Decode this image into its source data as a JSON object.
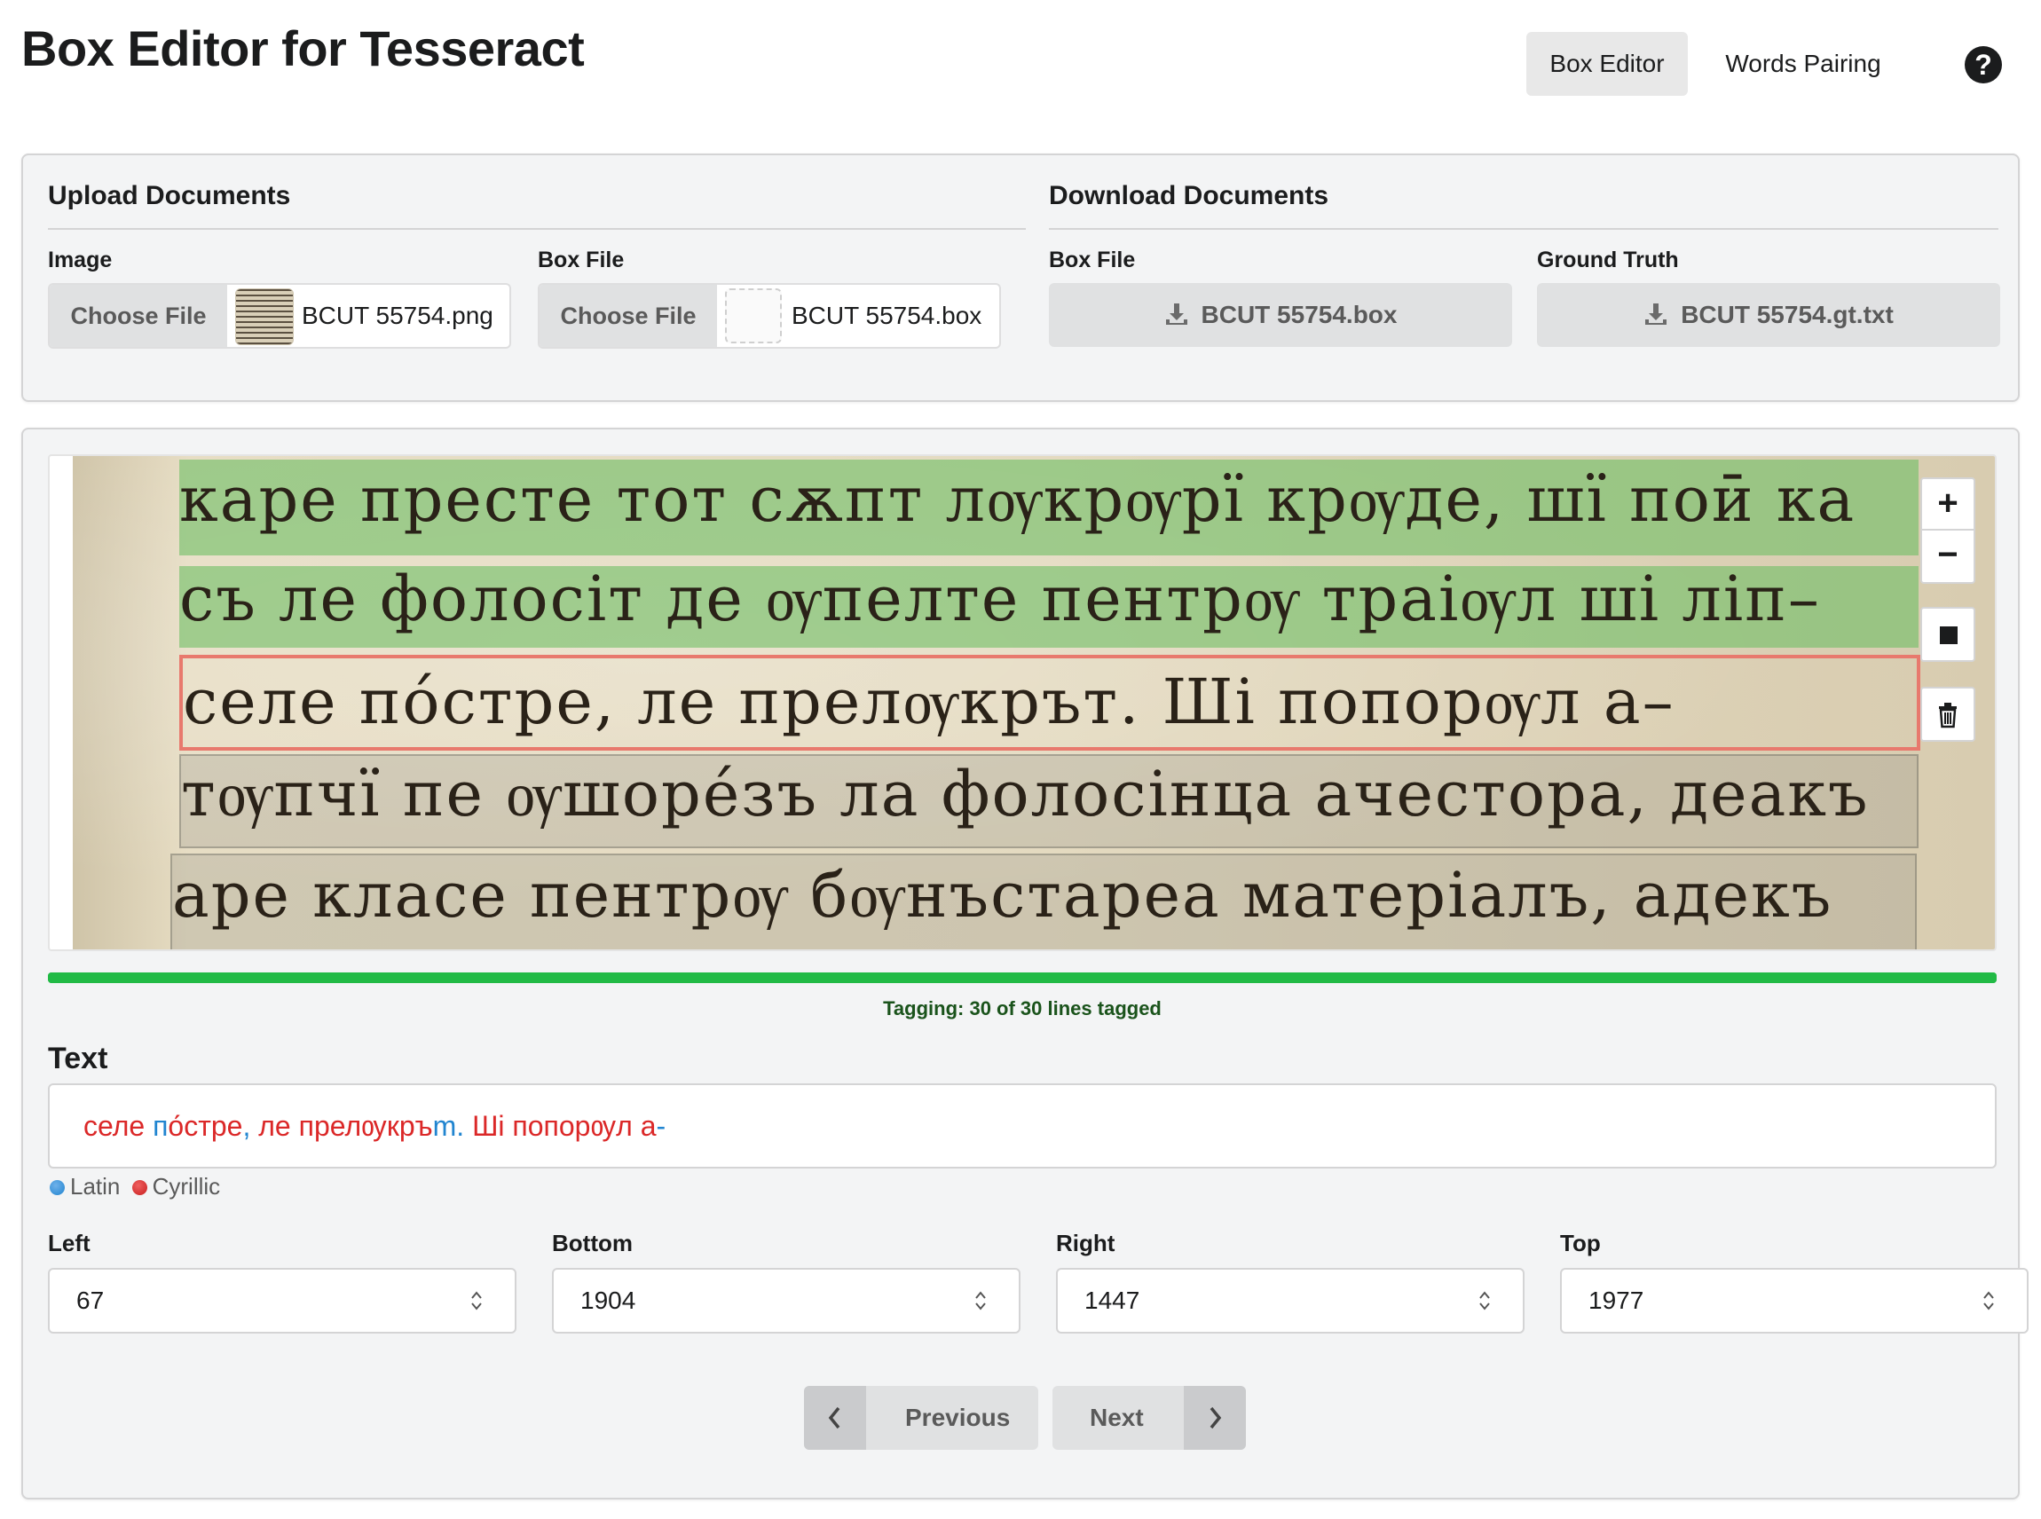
{
  "app": {
    "title": "Box Editor for Tesseract"
  },
  "nav": {
    "items": [
      {
        "label": "Box Editor",
        "active": true
      },
      {
        "label": "Words Pairing",
        "active": false
      }
    ],
    "help_icon": "question-circle-icon"
  },
  "upload": {
    "title": "Upload Documents",
    "image": {
      "label": "Image",
      "button": "Choose File",
      "filename": "BCUT 55754.png"
    },
    "box": {
      "label": "Box File",
      "button": "Choose File",
      "filename": "BCUT 55754.box"
    }
  },
  "download": {
    "title": "Download Documents",
    "box": {
      "label": "Box File",
      "button": "BCUT 55754.box",
      "icon": "download-icon"
    },
    "gt": {
      "label": "Ground Truth",
      "button": "BCUT 55754.gt.txt",
      "icon": "download-icon"
    }
  },
  "viewer": {
    "lines": [
      {
        "text": "каре престе тот сѫпт лѹкрѹрї крѹде, шї поӣ ка",
        "state": "tagged"
      },
      {
        "text": "съ ле фолосiт де ѹпелте пентрѹ траiѹл шi лiп–",
        "state": "tagged"
      },
      {
        "text": "селе по́стре, ле прелѹкрът. Шi попорѹл а–",
        "state": "selected"
      },
      {
        "text": "тѹпчї пе ѹшоре́зъ ла фолосiнца ачестора, деакъ",
        "state": "plain"
      },
      {
        "text": "аре класе пентрѹ бѹнъстареа матерiалъ, адекъ",
        "state": "plain"
      }
    ],
    "controls": {
      "zoom_in": "+",
      "zoom_out": "−",
      "draw_icon": "square-icon",
      "delete_icon": "trash-icon"
    }
  },
  "progress": {
    "tagged": 30,
    "total": 30,
    "label": "Tagging: 30 of 30 lines tagged",
    "color": "#21ba45"
  },
  "text_field": {
    "label": "Text",
    "segments": [
      {
        "t": "селе ",
        "script": "cyrillic"
      },
      {
        "t": "п",
        "script": "latin"
      },
      {
        "t": "о́стре",
        "script": "cyrillic"
      },
      {
        "t": ",",
        "script": "latin"
      },
      {
        "t": " ",
        "script": "cyrillic"
      },
      {
        "t": "ле прелѹкръ",
        "script": "cyrillic"
      },
      {
        "t": "m.",
        "script": "latin"
      },
      {
        "t": " ",
        "script": "cyrillic"
      },
      {
        "t": "Шi попорѹл а",
        "script": "cyrillic"
      },
      {
        "t": "-",
        "script": "latin"
      }
    ],
    "legend": {
      "latin": "Latin",
      "cyrillic": "Cyrillic"
    },
    "colors": {
      "latin": "#2185d0",
      "cyrillic": "#db2828"
    }
  },
  "coords": {
    "left": {
      "label": "Left",
      "value": "67"
    },
    "bottom": {
      "label": "Bottom",
      "value": "1904"
    },
    "right": {
      "label": "Right",
      "value": "1447"
    },
    "top": {
      "label": "Top",
      "value": "1977"
    }
  },
  "pager": {
    "previous": "Previous",
    "next": "Next"
  }
}
